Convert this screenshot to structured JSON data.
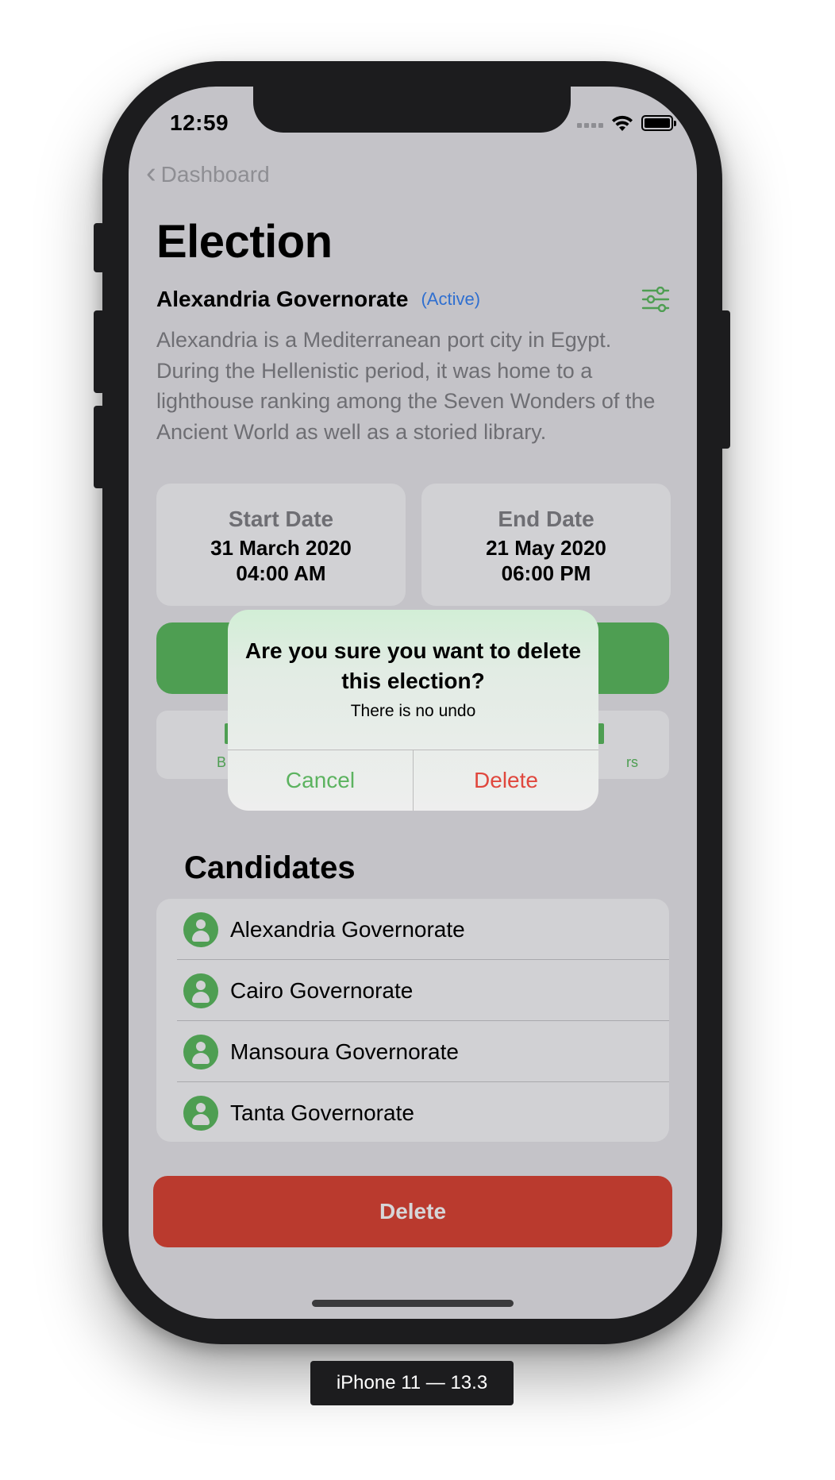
{
  "status_bar": {
    "time": "12:59",
    "wifi_icon": "wifi-icon",
    "battery_icon": "battery-icon"
  },
  "nav": {
    "back_label": "Dashboard",
    "back_icon": "chevron-left-icon"
  },
  "page": {
    "title": "Election",
    "election_name": "Alexandria Governorate",
    "status": "(Active)",
    "filter_icon": "sliders-icon",
    "description": "Alexandria is a Mediterranean port city in Egypt. During the Hellenistic period, it was home to a lighthouse ranking among the Seven Wonders of the Ancient World as well as a storied library."
  },
  "dates": {
    "start": {
      "label": "Start Date",
      "date": "31 March 2020",
      "time": "04:00 AM"
    },
    "end": {
      "label": "End Date",
      "date": "21 May 2020",
      "time": "06:00 PM"
    }
  },
  "toolbar": {
    "left_fragment": "B",
    "right_fragment": "rs"
  },
  "candidates": {
    "title": "Candidates",
    "items": [
      {
        "name": "Alexandria Governorate"
      },
      {
        "name": "Cairo Governorate"
      },
      {
        "name": "Mansoura Governorate"
      },
      {
        "name": "Tanta Governorate"
      }
    ]
  },
  "delete_label": "Delete",
  "alert": {
    "title": "Are you sure you want to delete this election?",
    "message": "There is no undo",
    "cancel_label": "Cancel",
    "delete_label": "Delete"
  },
  "device_label": "iPhone 11 — 13.3",
  "colors": {
    "accent_green": "#4e9e52",
    "destructive_red": "#ba3a2e",
    "status_blue": "#2f6fd0"
  }
}
